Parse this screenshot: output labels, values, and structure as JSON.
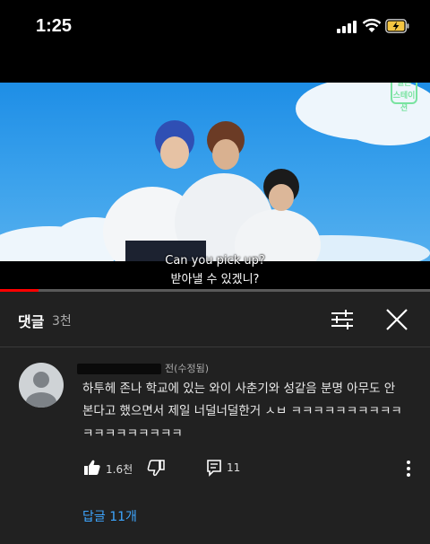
{
  "status_bar": {
    "time": "1:25"
  },
  "video": {
    "subtitle_en": "Can you pick up?",
    "subtitle_ko": "받아낼 수 있겠니?",
    "watermark": "멜론 스테이션",
    "progress": 0.09
  },
  "comments_panel": {
    "title": "댓글",
    "count": "3천",
    "filter_icon": "sliders-icon",
    "close_icon": "close-icon"
  },
  "comment": {
    "author_suffix": "전(수정됨)",
    "lines": [
      "하투헤 존나 학교에 있는 와이 사춘기와 성같음 분명 아무도 안",
      "본다고 했으면서 제일 너덜너덜한거 ㅅㅂ ㅋㅋㅋㅋㅋㅋㅋㅋㅋㅋ",
      "ㅋㅋㅋㅋㅋㅋㅋㅋㅋ"
    ],
    "likes": "1.6천",
    "replies": "11",
    "replies_link": "답글 11개"
  },
  "colors": {
    "accent_link": "#3ea6ff",
    "progress": "#ff0000",
    "panel_bg": "#212121"
  }
}
